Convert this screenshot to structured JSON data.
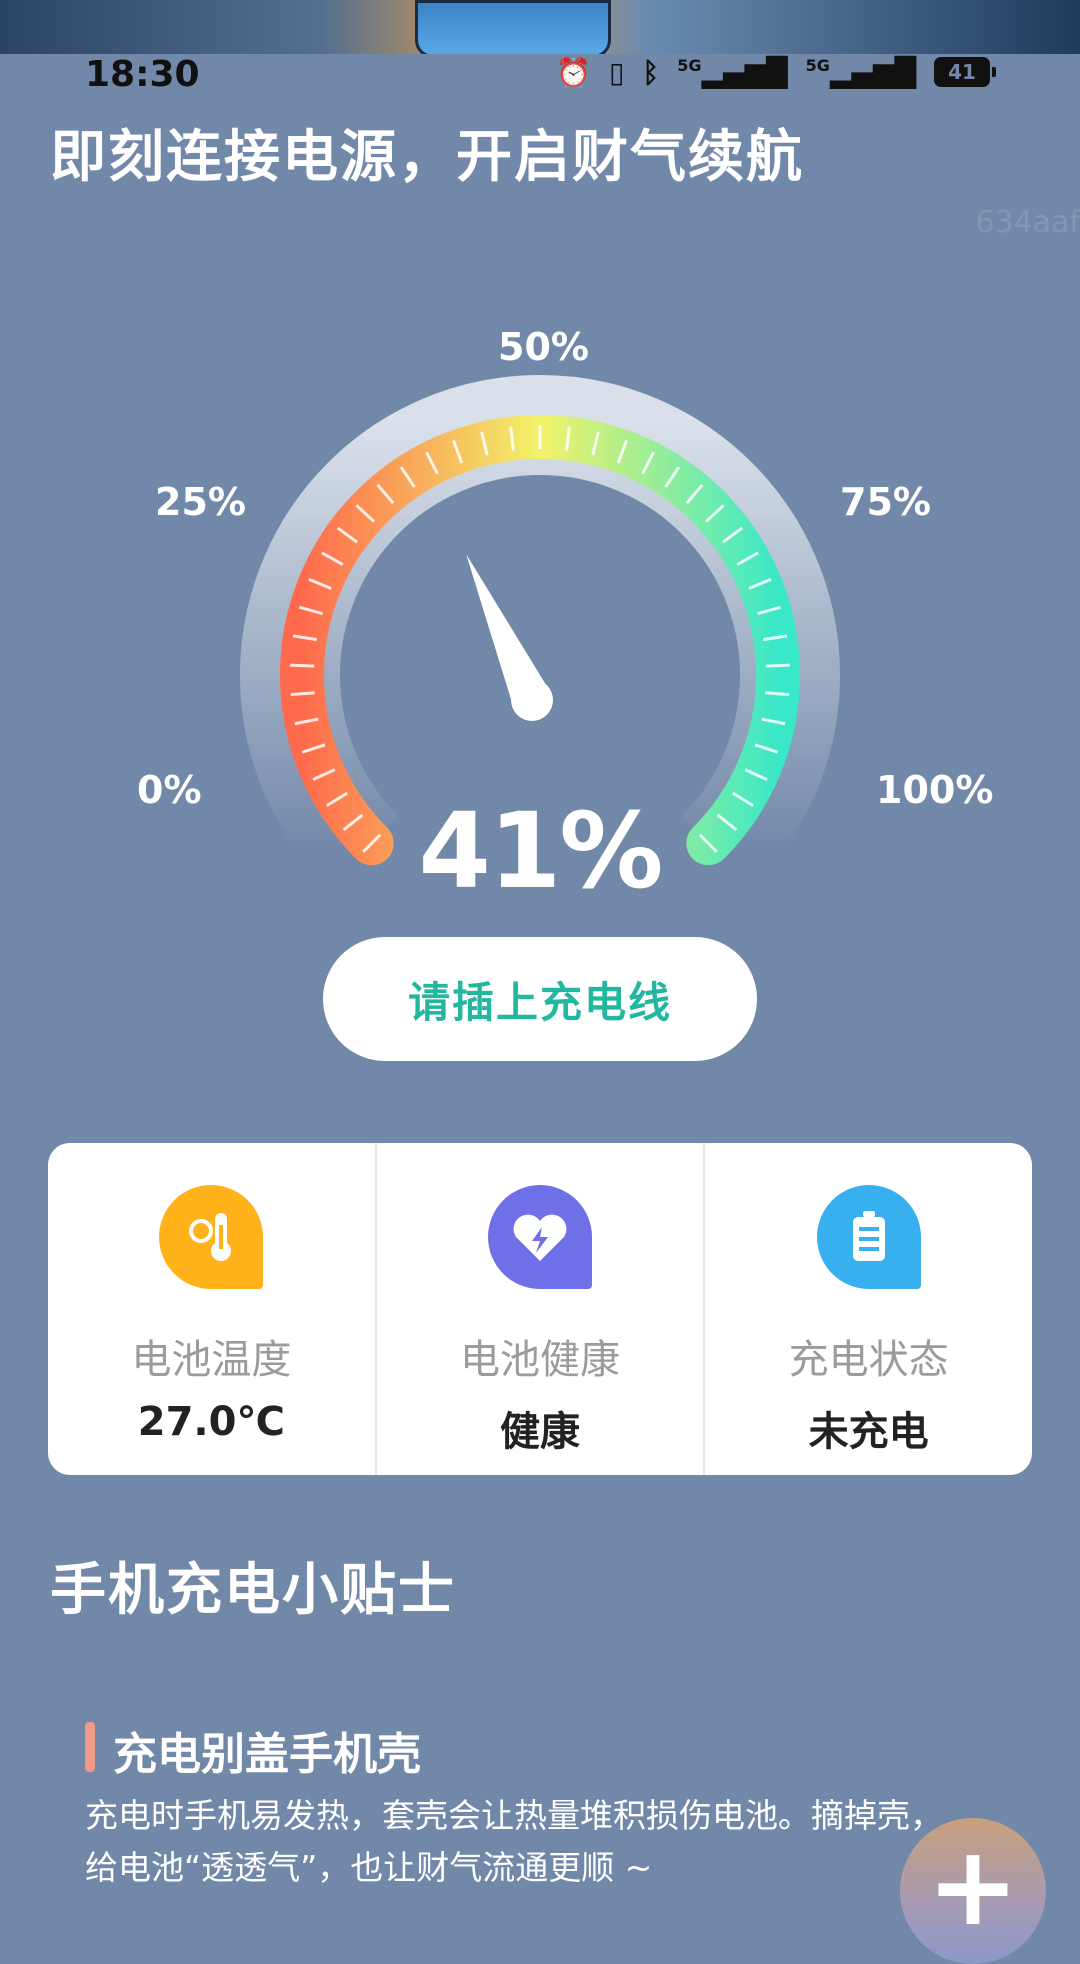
{
  "status_bar": {
    "time": "18:30",
    "icons": [
      "alarm-icon",
      "vibrate-icon",
      "bluetooth-icon",
      "signal-5g-icon",
      "signal-5g-icon"
    ],
    "signal_label_1": "5G",
    "signal_label_2": "5G",
    "battery": "41"
  },
  "headline": "即刻连接电源，开启财气续航",
  "watermark": "634aaf",
  "gauge": {
    "labels": {
      "p0": "0%",
      "p25": "25%",
      "p50": "50%",
      "p75": "75%",
      "p100": "100%"
    },
    "value": 41,
    "value_text": "41%",
    "colors": {
      "low": "#ff6a4c",
      "mid": "#f2f26a",
      "high": "#39e8c8"
    }
  },
  "plug_button": "请插上充电线",
  "cards": [
    {
      "icon": "thermometer-sun-icon",
      "label": "电池温度",
      "value": "27.0℃",
      "color": "#ffb21a"
    },
    {
      "icon": "heart-bolt-icon",
      "label": "电池健康",
      "value": "健康",
      "color": "#6f6fe8"
    },
    {
      "icon": "battery-icon",
      "label": "充电状态",
      "value": "未充电",
      "color": "#38b0ef"
    }
  ],
  "tips": {
    "title": "手机充电小贴士",
    "item_title": "充电别盖手机壳",
    "item_text": "充电时手机易发热，套壳会让热量堆积损伤电池。摘掉壳，给电池“透透气”，也让财气流通更顺 ~"
  },
  "fab": "+"
}
